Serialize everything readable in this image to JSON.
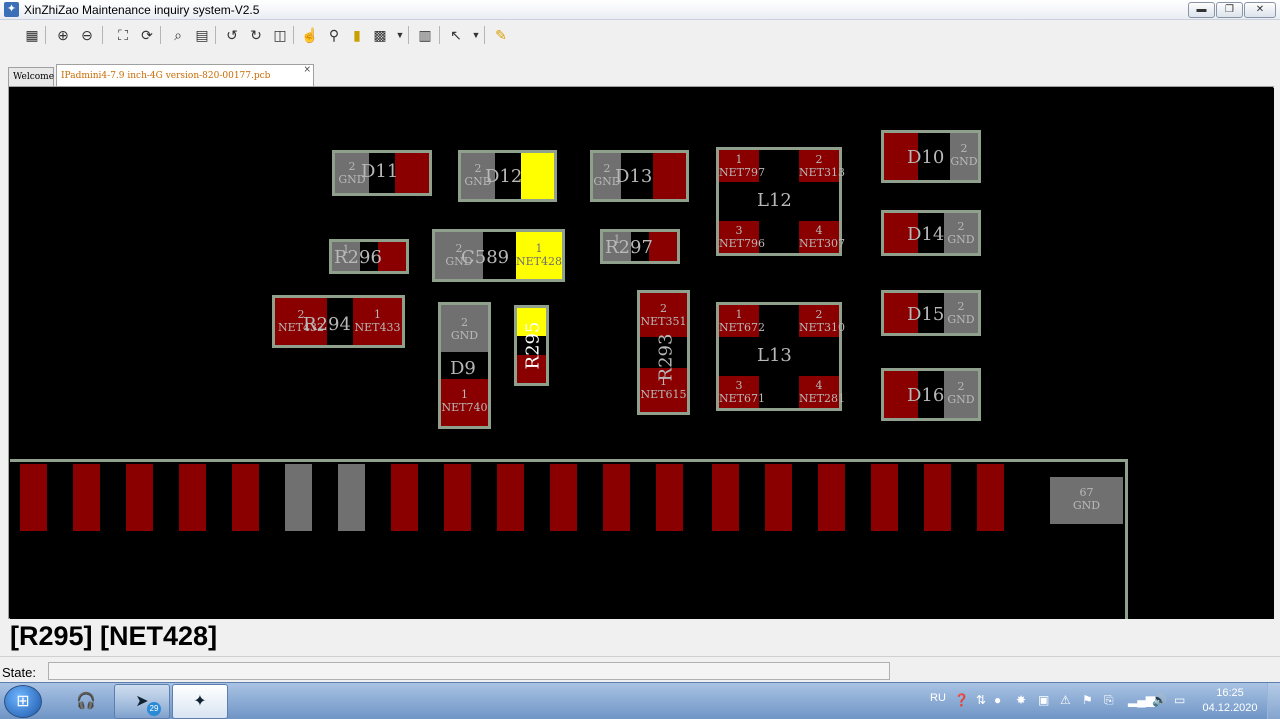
{
  "window": {
    "title": "XinZhiZao Maintenance inquiry system-V2.5",
    "minimize_label": "▬",
    "maximize_label": "❐",
    "close_label": "✕"
  },
  "toolbar": {
    "icons": [
      "tree-icon",
      "zoom-in-icon",
      "zoom-out-icon",
      "fit-icon",
      "refresh-icon",
      "search-icon",
      "find-net-icon",
      "rotate-left-icon",
      "rotate-right-icon",
      "flip-icon",
      "hand-icon",
      "probe-icon",
      "marker-icon",
      "zoom-percent-icon",
      "grid-icon",
      "pointer-icon",
      "note-icon"
    ]
  },
  "tabs": {
    "welcome": "Welcome",
    "pcb": "IPadmini4-7.9 inch-4G version-820-00177.pcb",
    "close": "×"
  },
  "board": {
    "d11": {
      "ref": "D11",
      "pad2_num": "2",
      "pad2_net": "GND"
    },
    "d12": {
      "ref": "D12",
      "pad2_num": "2",
      "pad2_net": "GND"
    },
    "d13": {
      "ref": "D13",
      "pad2_num": "2",
      "pad2_net": "GND"
    },
    "l12": {
      "ref": "L12",
      "p1_num": "1",
      "p1_net": "NET797",
      "p2_num": "2",
      "p2_net": "NET313",
      "p3_num": "3",
      "p3_net": "NET796",
      "p4_num": "4",
      "p4_net": "NET307"
    },
    "d10": {
      "ref": "D10",
      "pad2_num": "2",
      "pad2_net": "GND"
    },
    "d14": {
      "ref": "D14",
      "pad2_num": "2",
      "pad2_net": "GND"
    },
    "d15": {
      "ref": "D15",
      "pad2_num": "2",
      "pad2_net": "GND"
    },
    "d16": {
      "ref": "D16",
      "pad2_num": "2",
      "pad2_net": "GND"
    },
    "r296": {
      "ref": "R296",
      "pad1_num": "1"
    },
    "c589": {
      "ref": "C589",
      "pad2_num": "2",
      "pad2_net": "GND",
      "pad1_num": "1",
      "pad1_net": "NET428"
    },
    "r297": {
      "ref": "R297",
      "pad1_num": "1"
    },
    "r294": {
      "ref": "R294",
      "pad2_num": "2",
      "pad2_net": "NET432",
      "pad1_num": "1",
      "pad1_net": "NET433"
    },
    "d9": {
      "ref": "D9",
      "pad2_num": "2",
      "pad2_net": "GND",
      "pad1_num": "1",
      "pad1_net": "NET740"
    },
    "r295": {
      "ref": "R295"
    },
    "r293": {
      "ref": "R293",
      "pad2_num": "2",
      "pad2_net": "NET351",
      "pad1_num": "1",
      "pad1_net": "NET615"
    },
    "l13": {
      "ref": "L13",
      "p1_num": "1",
      "p1_net": "NET672",
      "p2_num": "2",
      "p2_net": "NET310",
      "p3_num": "3",
      "p3_net": "NET671",
      "p4_num": "4",
      "p4_net": "NET281"
    },
    "connector": {
      "gnd_num": "67",
      "gnd_net": "GND"
    }
  },
  "colors": {
    "pad_red": "#8a0000",
    "pad_gray": "#707070",
    "pad_highlight": "#ffff00",
    "outline": "#8fa08d",
    "board_bg": "#000000"
  },
  "selection_text": "[R295] [NET428]",
  "status": {
    "label": "State:",
    "value": ""
  },
  "taskbar": {
    "lang": "RU",
    "badge": "29",
    "time": "16:25",
    "date": "04.12.2020"
  }
}
